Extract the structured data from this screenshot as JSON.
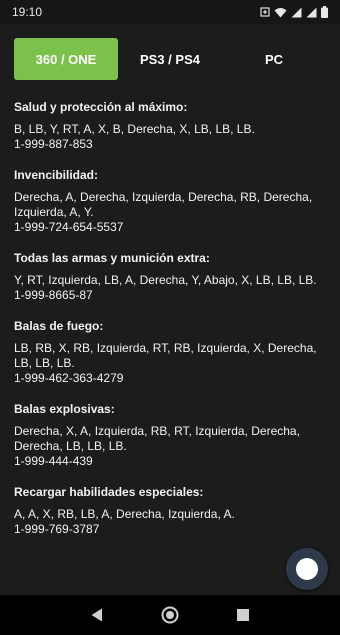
{
  "status_bar": {
    "time": "19:10"
  },
  "tabs": [
    {
      "label": "360 / ONE",
      "active": true
    },
    {
      "label": "PS3 / PS4",
      "active": false
    },
    {
      "label": "PC",
      "active": false
    }
  ],
  "cheats": [
    {
      "title": "Salud y protección al máximo:",
      "combo": "B, LB, Y, RT, A, X, B, Derecha, X, LB, LB, LB.",
      "phone": "1-999-887-853"
    },
    {
      "title": "Invencibilidad:",
      "combo": "Derecha, A, Derecha, Izquierda, Derecha, RB, Derecha, Izquierda, A, Y.",
      "phone": "1-999-724-654-5537"
    },
    {
      "title": "Todas las armas y munición extra:",
      "combo": "Y, RT, Izquierda, LB, A, Derecha, Y, Abajo, X, LB, LB, LB.",
      "phone": "1-999-8665-87"
    },
    {
      "title": "Balas de fuego:",
      "combo": "LB, RB, X, RB, Izquierda, RT, RB, Izquierda, X, Derecha, LB, LB, LB.",
      "phone": "1-999-462-363-4279"
    },
    {
      "title": "Balas explosivas:",
      "combo": "Derecha, X, A, Izquierda, RB, RT, Izquierda, Derecha, Derecha, LB, LB, LB.",
      "phone": "1-999-444-439"
    },
    {
      "title": "Recargar habilidades especiales:",
      "combo": "A, A, X, RB, LB, A, Derecha, Izquierda, A.",
      "phone": "1-999-769-3787"
    }
  ],
  "colors": {
    "accent": "#7cc24a",
    "background": "#1c1c1c"
  },
  "icons": {
    "status": [
      "notification-icon",
      "wifi-icon",
      "signal-icon",
      "signal-icon",
      "battery-icon"
    ],
    "nav": [
      "back-icon",
      "home-icon",
      "recents-icon"
    ],
    "fab": "assistive-touch-icon"
  }
}
